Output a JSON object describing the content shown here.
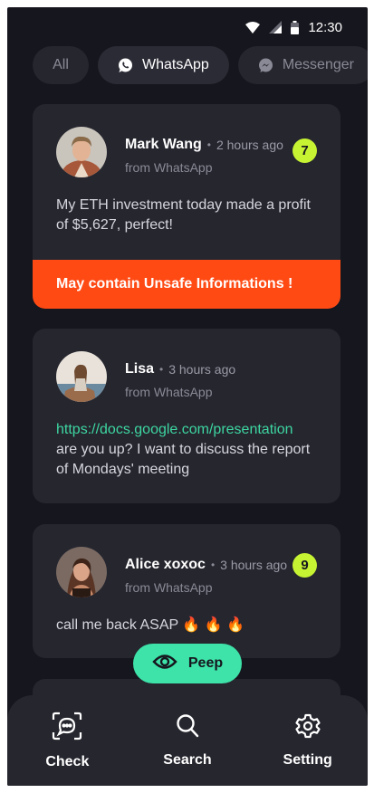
{
  "status_bar": {
    "time": "12:30"
  },
  "tabs": [
    {
      "label": "All",
      "active": false
    },
    {
      "label": "WhatsApp",
      "active": true,
      "icon": "whatsapp-icon"
    },
    {
      "label": "Messenger",
      "active": false,
      "icon": "messenger-icon"
    }
  ],
  "messages": [
    {
      "name": "Mark Wang",
      "time": "2 hours ago",
      "source": "from WhatsApp",
      "badge": "7",
      "text": "My ETH investment today made a profit of $5,627, perfect!",
      "warning": "May contain Unsafe Informations !"
    },
    {
      "name": "Lisa",
      "time": "3 hours ago",
      "source": "from WhatsApp",
      "link": "https://docs.google.com/presentation",
      "text": "are you up? I want to discuss the report of Mondays' meeting"
    },
    {
      "name": "Alice xoxoc",
      "time": "3 hours ago",
      "source": "from WhatsApp",
      "badge": "9",
      "text": "call me back ASAP 🔥 🔥 🔥"
    }
  ],
  "peep_button": {
    "label": "Peep",
    "icon": "eye-icon"
  },
  "bottom_nav": [
    {
      "label": "Check",
      "icon": "chat-scan-icon"
    },
    {
      "label": "Search",
      "icon": "search-icon"
    },
    {
      "label": "Setting",
      "icon": "gear-icon"
    }
  ],
  "colors": {
    "background": "#16161e",
    "card": "#26262f",
    "accent_green": "#3de3a8",
    "badge": "#c6f432",
    "warning": "#ff4a14",
    "link": "#3dd6a0"
  }
}
